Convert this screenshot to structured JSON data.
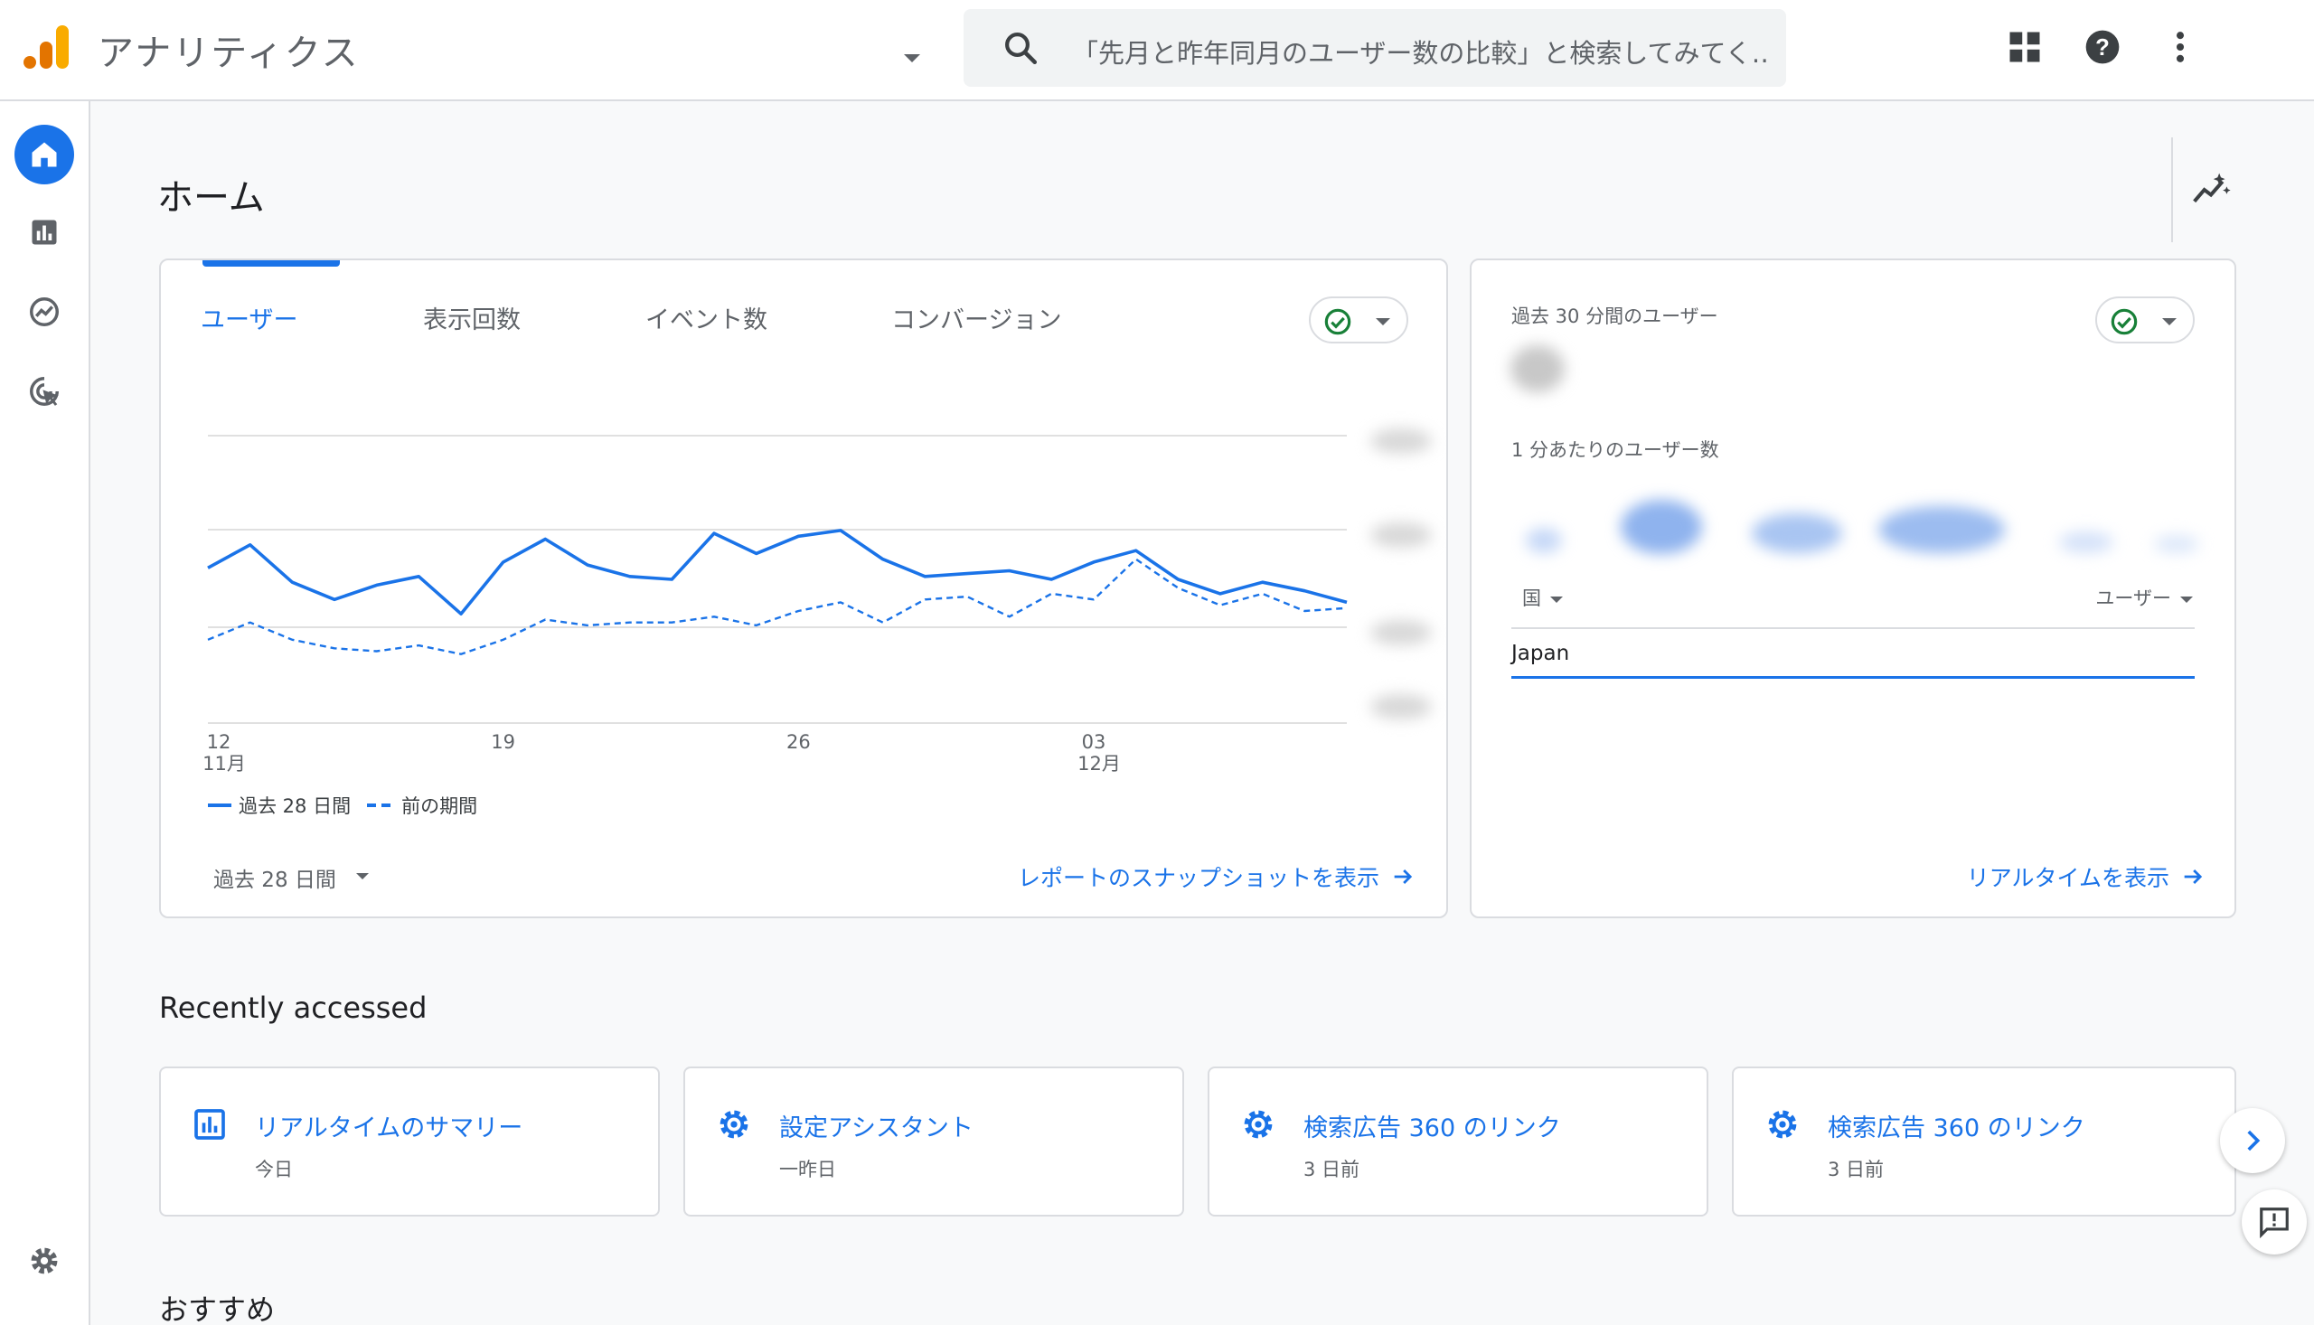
{
  "app": {
    "title": "アナリティクス"
  },
  "search": {
    "placeholder": "「先月と昨年同月のユーザー数の比較」と検索してみてく…"
  },
  "page": {
    "title": "ホーム"
  },
  "overview_card": {
    "tabs": [
      "ユーザー",
      "表示回数",
      "イベント数",
      "コンバージョン"
    ],
    "active_tab": "ユーザー",
    "legend": {
      "current": "過去 28 日間",
      "previous": "前の期間"
    },
    "date_range": "過去 28 日間",
    "link": "レポートのスナップショットを表示"
  },
  "chart_data": {
    "type": "line",
    "title": "",
    "x_tick_labels": [
      {
        "day": "12",
        "month": "11月"
      },
      {
        "day": "19",
        "month": ""
      },
      {
        "day": "26",
        "month": ""
      },
      {
        "day": "03",
        "month": "12月"
      }
    ],
    "series": [
      {
        "name": "過去 28 日間",
        "style": "solid",
        "values": [
          54,
          62,
          49,
          43,
          48,
          51,
          38,
          56,
          64,
          55,
          51,
          50,
          66,
          59,
          65,
          67,
          57,
          51,
          52,
          53,
          50,
          56,
          60,
          50,
          45,
          49,
          46,
          42
        ]
      },
      {
        "name": "前の期間",
        "style": "dashed",
        "values": [
          29,
          35,
          29,
          26,
          25,
          27,
          24,
          29,
          36,
          34,
          35,
          35,
          37,
          34,
          39,
          42,
          35,
          43,
          44,
          37,
          45,
          43,
          57,
          47,
          41,
          45,
          39,
          40
        ]
      }
    ],
    "y_axis_labels_obscured": true,
    "grid": true,
    "colors": {
      "line": "#1a73e8"
    }
  },
  "realtime_card": {
    "users_label": "過去 30 分間のユーザー",
    "per_minute_label": "1 分あたりのユーザー数",
    "col_country": "国",
    "col_users": "ユーザー",
    "row_country": "Japan",
    "link": "リアルタイムを表示"
  },
  "recent": {
    "title": "Recently accessed",
    "items": [
      {
        "icon": "bar-chart-icon",
        "title": "リアルタイムのサマリー",
        "sub": "今日"
      },
      {
        "icon": "gear-icon",
        "title": "設定アシスタント",
        "sub": "一昨日"
      },
      {
        "icon": "gear-icon",
        "title": "検索広告 360 のリンク",
        "sub": "3 日前"
      },
      {
        "icon": "gear-icon",
        "title": "検索広告 360 のリンク",
        "sub": "3 日前"
      }
    ]
  },
  "recommended": {
    "title": "おすすめ"
  },
  "colors": {
    "accent": "#1a73e8",
    "success": "#188038",
    "logo_orange": "#f9ab00",
    "logo_dark": "#e37400"
  }
}
